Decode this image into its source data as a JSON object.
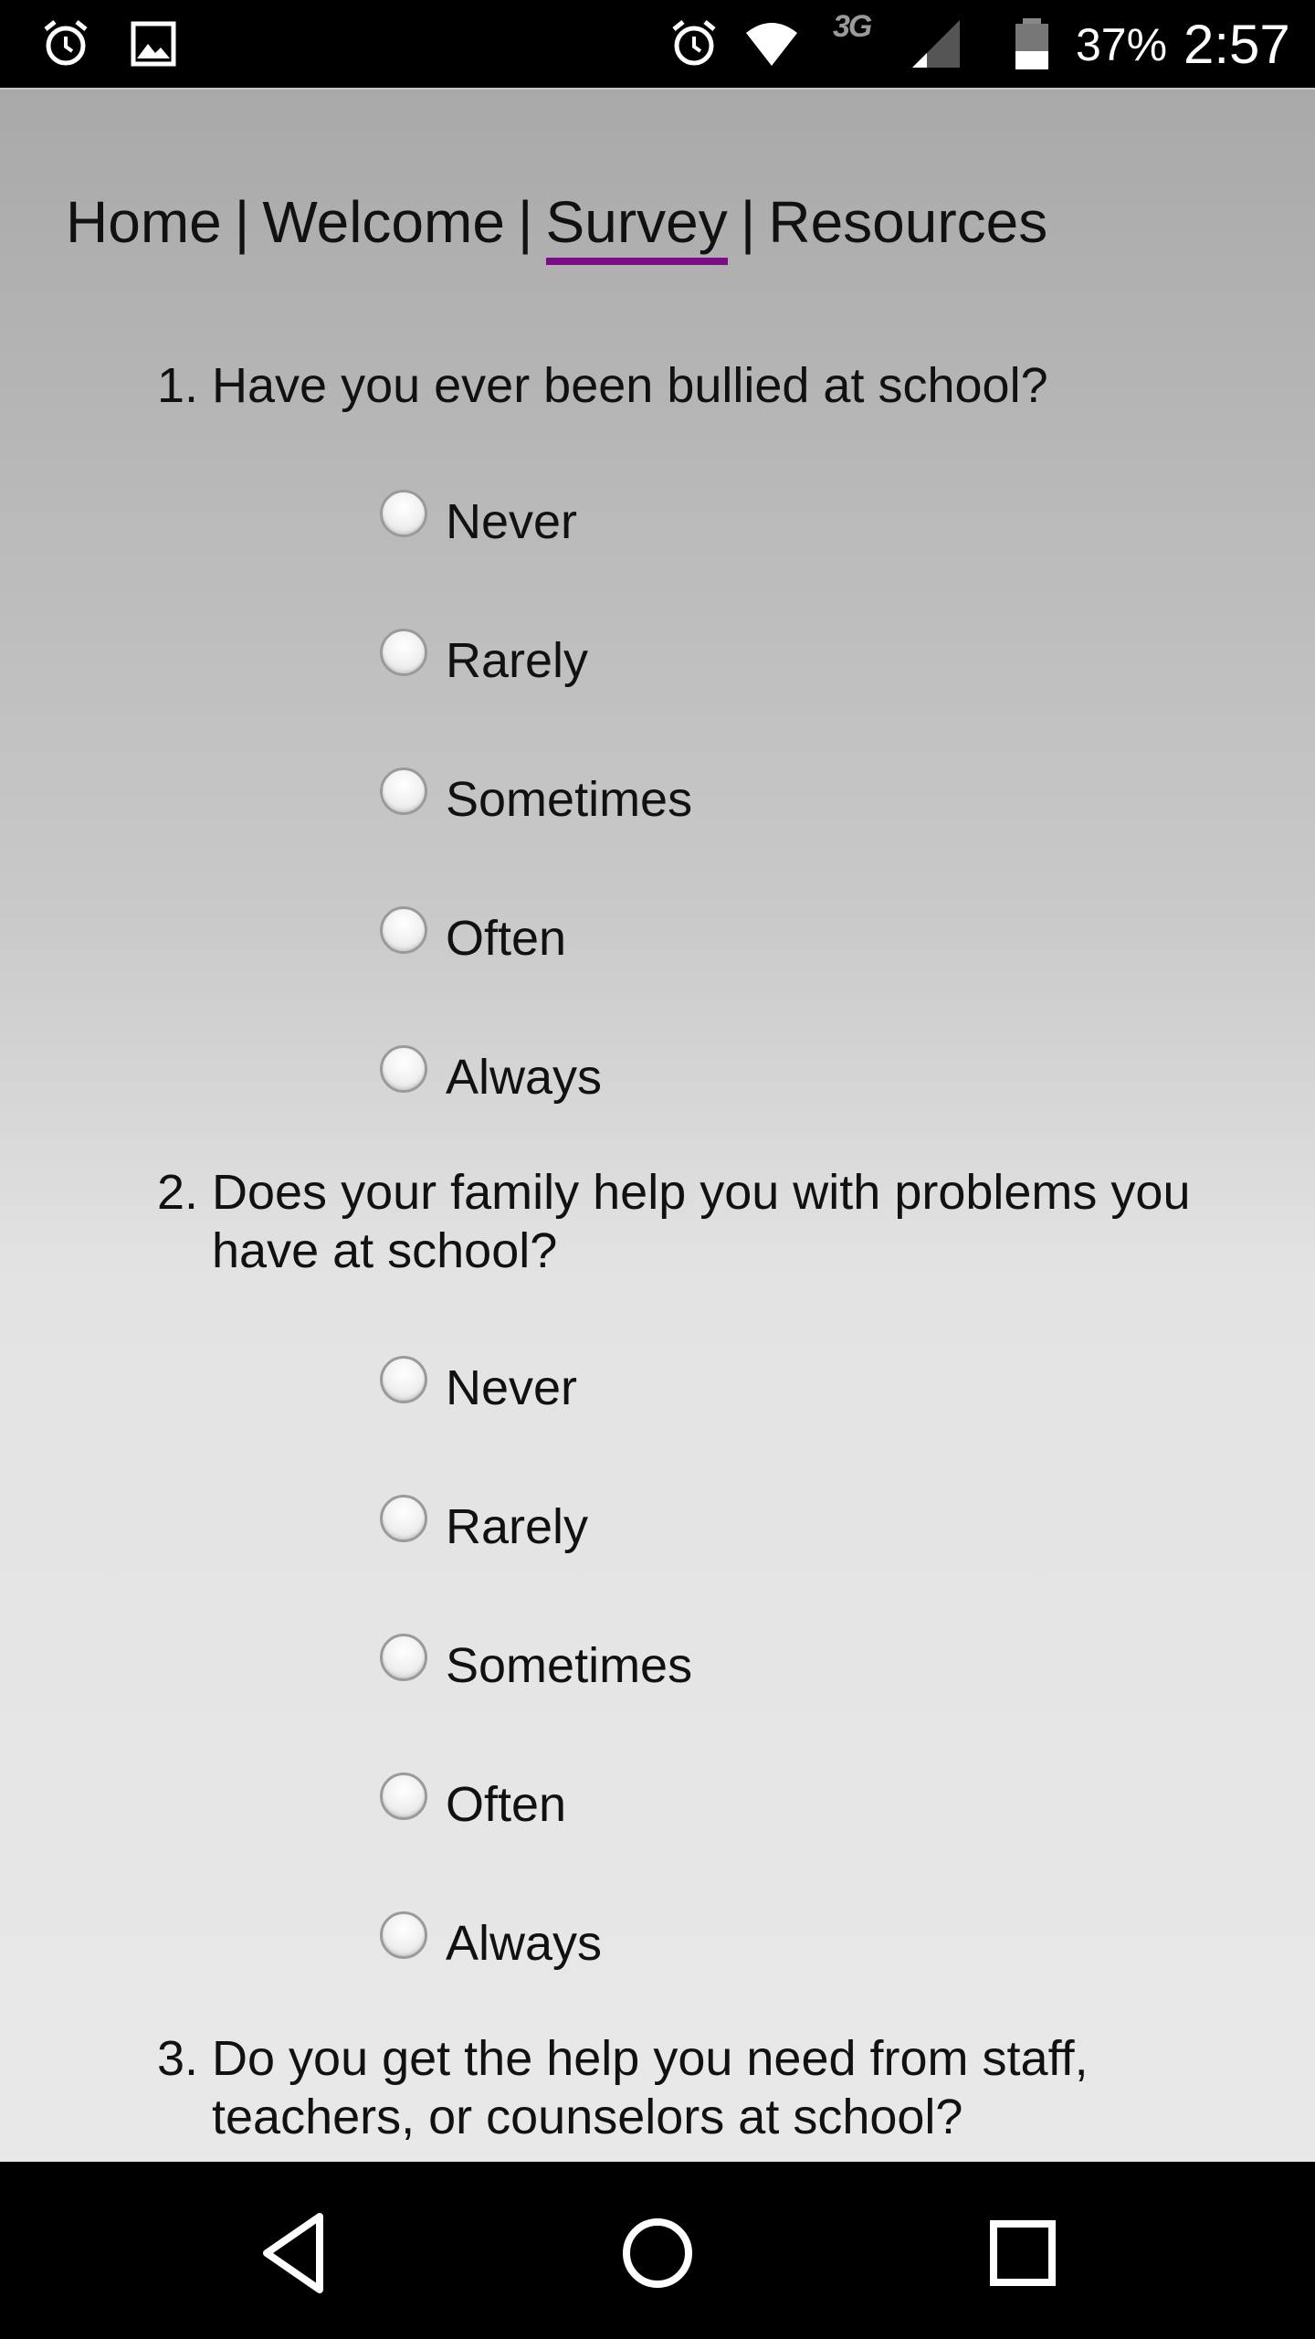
{
  "status_bar": {
    "battery_percent": "37%",
    "time": "2:57",
    "network_type": "3G",
    "icons": [
      "alarm-icon",
      "gallery-icon",
      "alarm-icon",
      "wifi-icon",
      "signal-icon",
      "battery-icon"
    ]
  },
  "nav": {
    "items": [
      "Home",
      "Welcome",
      "Survey",
      "Resources"
    ],
    "separator": "|",
    "active": "Survey",
    "active_color": "#7a0d86"
  },
  "questions": [
    {
      "number": "1.",
      "text": "Have you ever been bullied at school?",
      "options": [
        "Never",
        "Rarely",
        "Sometimes",
        "Often",
        "Always"
      ]
    },
    {
      "number": "2.",
      "text": "Does your family help you with problems you have at school?",
      "options": [
        "Never",
        "Rarely",
        "Sometimes",
        "Often",
        "Always"
      ]
    },
    {
      "number": "3.",
      "text": "Do you get the help you need from staff, teachers, or counselors at school?",
      "options": []
    }
  ],
  "system_nav": {
    "icons": [
      "back-icon",
      "home-icon",
      "recents-icon"
    ]
  }
}
